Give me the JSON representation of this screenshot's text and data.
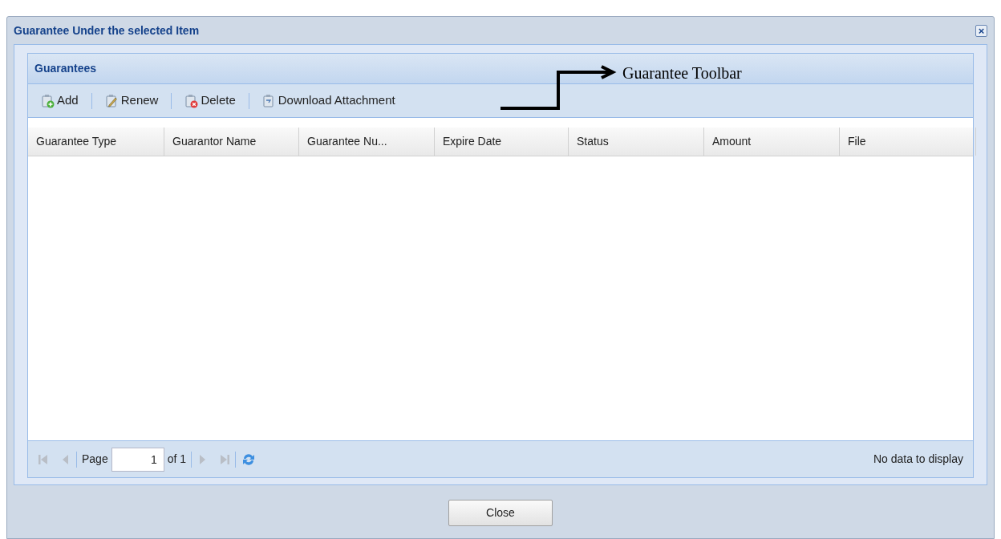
{
  "window": {
    "title": "Guarantee Under the selected Item",
    "close_symbol": "×"
  },
  "panel": {
    "title": "Guarantees",
    "toolbar": [
      {
        "kind": "add",
        "label": "Add"
      },
      {
        "kind": "edit",
        "label": "Renew"
      },
      {
        "kind": "delete",
        "label": "Delete"
      },
      {
        "kind": "download",
        "label": "Download Attachment"
      }
    ],
    "columns": [
      "Guarantee Type",
      "Guarantor Name",
      "Guarantee Nu...",
      "Expire Date",
      "Status",
      "Amount",
      "File"
    ],
    "pager": {
      "first_disabled": true,
      "prev_disabled": true,
      "page_label": "Page",
      "page_value": "1",
      "of_label": "of 1",
      "next_disabled": true,
      "last_disabled": true,
      "status": "No data to display"
    }
  },
  "annotation": {
    "label": "Guarantee Toolbar"
  },
  "buttons": [
    "Close"
  ]
}
